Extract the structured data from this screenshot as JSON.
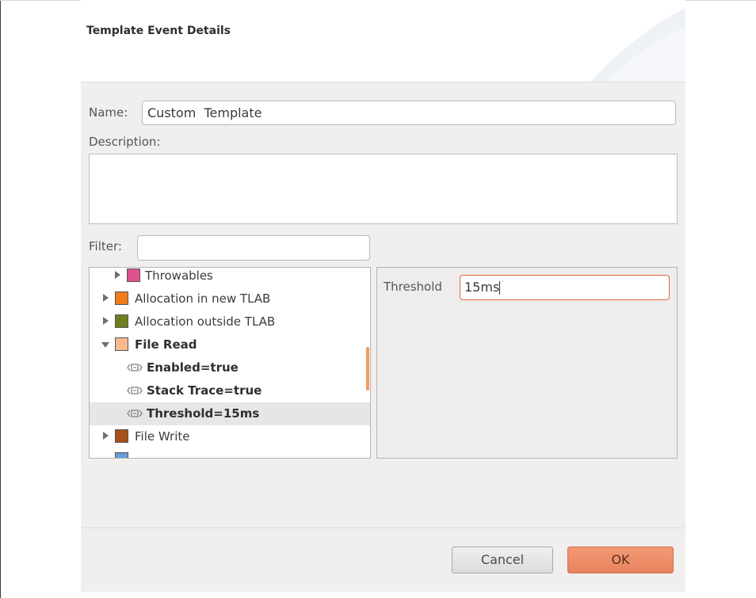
{
  "header": {
    "title": "Template Event Details"
  },
  "form": {
    "name_label": "Name:",
    "name_value": "Custom  Template",
    "description_label": "Description:",
    "description_value": "",
    "filter_label": "Filter:",
    "filter_value": ""
  },
  "tree": {
    "items": [
      {
        "label": "Throwables",
        "color": "#e0508f",
        "expanded": false,
        "bold": false
      },
      {
        "label": "Allocation in new TLAB",
        "color": "#f07d1a",
        "expanded": false,
        "bold": false
      },
      {
        "label": "Allocation outside TLAB",
        "color": "#6f7f1f",
        "expanded": false,
        "bold": false
      },
      {
        "label": "File Read",
        "color": "#f8b98f",
        "expanded": true,
        "bold": true
      },
      {
        "label": "Enabled=true",
        "icon": "setting-icon",
        "bold": true
      },
      {
        "label": "Stack Trace=true",
        "icon": "setting-icon",
        "bold": true
      },
      {
        "label": "Threshold=15ms",
        "icon": "setting-icon",
        "bold": true,
        "selected": true
      },
      {
        "label": "File Write",
        "color": "#a8501a",
        "expanded": false,
        "bold": false
      }
    ]
  },
  "detail": {
    "field_label": "Threshold",
    "field_value": "15ms"
  },
  "buttons": {
    "cancel_label": "Cancel",
    "ok_label": "OK"
  },
  "colors": {
    "accent": "#e26b34",
    "ok_button": "#ef8e6b"
  }
}
